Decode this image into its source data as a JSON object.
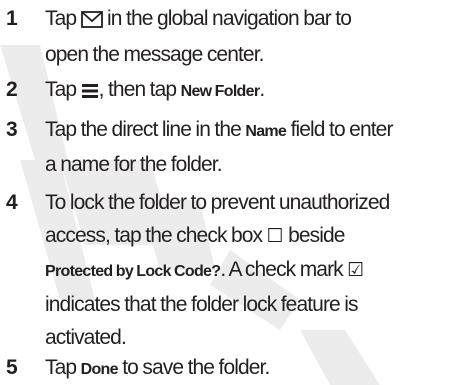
{
  "watermark": {
    "text": "DRAFT",
    "color": "#ececec"
  },
  "text_color": "#231f20",
  "icons": {
    "envelope": "envelope-icon",
    "menu": "menu-icon",
    "checkbox_empty": "☐",
    "checkbox_checked": "☑"
  },
  "steps": [
    {
      "number": "1",
      "line1_a": "Tap",
      "line1_b": "in the global navigation bar to",
      "line2": "open the message center."
    },
    {
      "number": "2",
      "a": "Tap",
      "b": ", then tap",
      "key": "New Folder",
      "c": "."
    },
    {
      "number": "3",
      "a": "Tap the direct line in the",
      "key": "Name",
      "b": "field to enter",
      "line2": "a name for the folder."
    },
    {
      "number": "4",
      "line1": "To lock the folder to prevent unauthorized",
      "line2": "access, tap the check box",
      "line2_end": "beside",
      "key": "Protected by Lock Code?",
      "line3_rest": ". A check mark",
      "line4": "indicates that the folder lock feature is",
      "line5": "activated."
    },
    {
      "number": "5",
      "a": "Tap",
      "key": "Done",
      "b": "to save the folder."
    }
  ]
}
